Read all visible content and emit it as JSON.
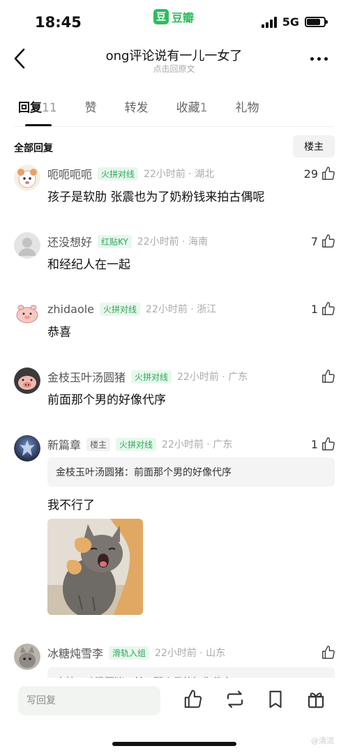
{
  "status": {
    "time": "18:45",
    "app_logo": "豆",
    "app_name": "豆瓣",
    "network": "5G"
  },
  "nav": {
    "title": "ong评论说有一儿一女了",
    "subtitle": "点击回原文"
  },
  "tabs": [
    {
      "label": "回复",
      "count": "11"
    },
    {
      "label": "赞",
      "count": ""
    },
    {
      "label": "转发",
      "count": ""
    },
    {
      "label": "收藏",
      "count": "1"
    },
    {
      "label": "礼物",
      "count": ""
    }
  ],
  "section": {
    "title": "全部回复",
    "op_filter": "楼主"
  },
  "comments": [
    {
      "user": "呃呃呃呃",
      "badges": [
        "火拼对线"
      ],
      "meta": "22小时前 · 湖北",
      "likes": "29",
      "text": "孩子是软肋 张震也为了奶粉钱来拍古偶呢"
    },
    {
      "user": "还没想好",
      "badges": [
        "红贴KY"
      ],
      "meta": "22小时前 · 海南",
      "likes": "7",
      "text": "和经纪人在一起"
    },
    {
      "user": "zhidaole",
      "badges": [
        "火拼对线"
      ],
      "meta": "22小时前 · 浙江",
      "likes": "1",
      "text": "恭喜"
    },
    {
      "user": "金枝玉叶汤圆猪",
      "badges": [
        "火拼对线"
      ],
      "meta": "22小时前 · 广东",
      "likes": "",
      "text": "前面那个男的好像代序"
    },
    {
      "user": "新篇章",
      "op_badge": "楼主",
      "badges": [
        "火拼对线"
      ],
      "meta": "22小时前 · 广东",
      "likes": "1",
      "quote": "金枝玉叶汤圆猪：前面那个男的好像代序",
      "text": "我不行了"
    },
    {
      "user": "冰糖炖雪李",
      "badges": [
        "滑轨入组"
      ],
      "meta": "22小时前 · 山东",
      "likes": "",
      "quote": "金枝玉叶汤圆猪：前面那个男的好像代序"
    }
  ],
  "bottom": {
    "reply_placeholder": "写回复",
    "watermark": "@清流"
  },
  "colors": {
    "accent": "#2dbd5d",
    "badge_bg": "#e9f7ee",
    "badge_text": "#2aa855"
  }
}
